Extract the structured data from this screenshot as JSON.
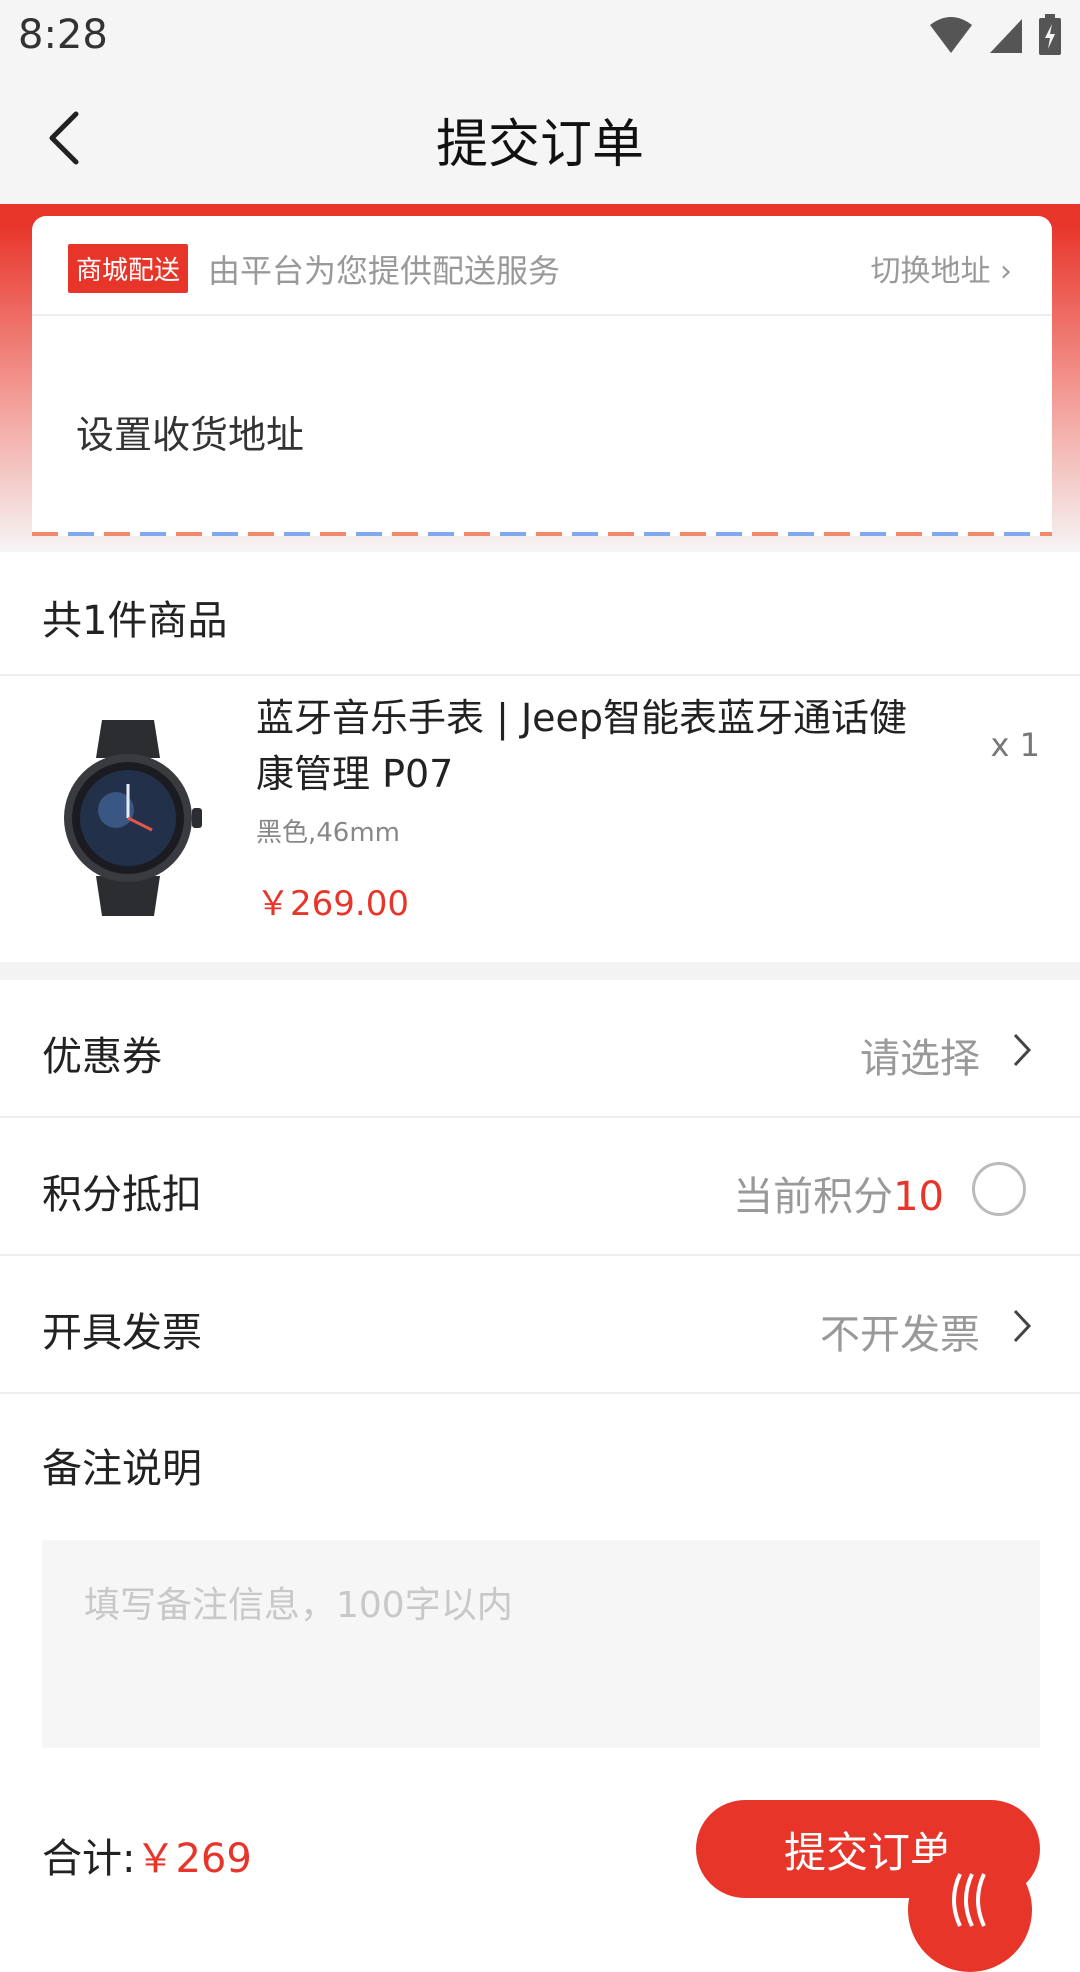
{
  "status_bar": {
    "time": "8:28"
  },
  "header": {
    "title": "提交订单"
  },
  "delivery": {
    "badge": "商城配送",
    "description": "由平台为您提供配送服务",
    "switch_label": "切换地址",
    "address_prompt": "设置收货地址"
  },
  "items_section": {
    "title": "共1件商品"
  },
  "product": {
    "title": "蓝牙音乐手表 | Jeep智能表蓝牙通话健康管理 P07",
    "spec": "黑色,46mm",
    "price": "￥269.00",
    "quantity": "x 1"
  },
  "coupon": {
    "label": "优惠券",
    "value": "请选择"
  },
  "points": {
    "label": "积分抵扣",
    "prefix": "当前积分",
    "value": "10"
  },
  "invoice": {
    "label": "开具发票",
    "value": "不开发票"
  },
  "remark": {
    "label": "备注说明",
    "placeholder": "填写备注信息，100字以内"
  },
  "footer": {
    "total_label": "合计:",
    "total_value": "￥269",
    "submit_label": "提交订单"
  },
  "colors": {
    "accent": "#e8352a"
  }
}
